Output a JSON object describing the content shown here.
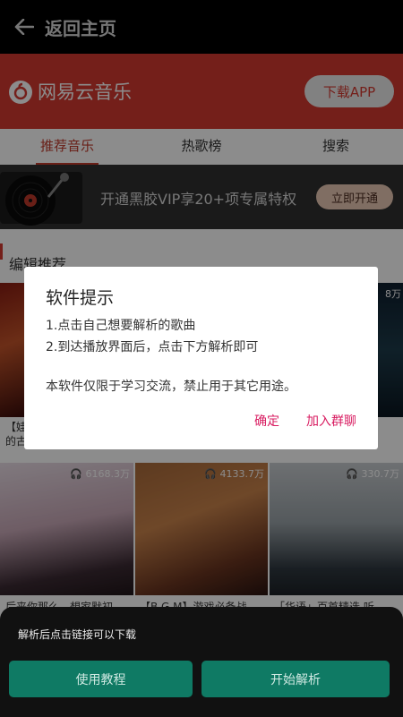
{
  "topbar": {
    "title": "返回主页"
  },
  "brand": {
    "name": "网易云音乐",
    "download_label": "下载APP"
  },
  "tabs": [
    {
      "label": "推荐音乐"
    },
    {
      "label": "热歌榜"
    },
    {
      "label": "搜索"
    }
  ],
  "vip": {
    "text": "开通黑胶VIP享20+项专属特权",
    "button_label": "立即开通"
  },
  "section": {
    "title": "编辑推荐"
  },
  "playlists_row1": [
    {
      "caption": "【娃",
      "caption2": "的古"
    },
    {
      "count": "8万"
    }
  ],
  "playlists_row2": [
    {
      "count": "6168.3万",
      "caption": "后来你那么…想家默初"
    },
    {
      "count": "4133.7万",
      "caption": "【B.G.M】游戏必备战"
    },
    {
      "count": "330.7万",
      "caption": "「华语」百首精选 听"
    }
  ],
  "dialog": {
    "title": "软件提示",
    "line1": "1.点击自己想要解析的歌曲",
    "line2": "2.到达播放界面后，点击下方解析即可",
    "line3": "本软件仅限于学习交流，禁止用于其它用途。",
    "confirm_label": "确定",
    "join_label": "加入群聊"
  },
  "sheet": {
    "hint": "解析后点击链接可以下载",
    "tutorial_label": "使用教程",
    "start_label": "开始解析"
  },
  "colors": {
    "brand_red": "#d33a31",
    "accent_pink": "#d81b60",
    "teal": "#0f7a64"
  }
}
